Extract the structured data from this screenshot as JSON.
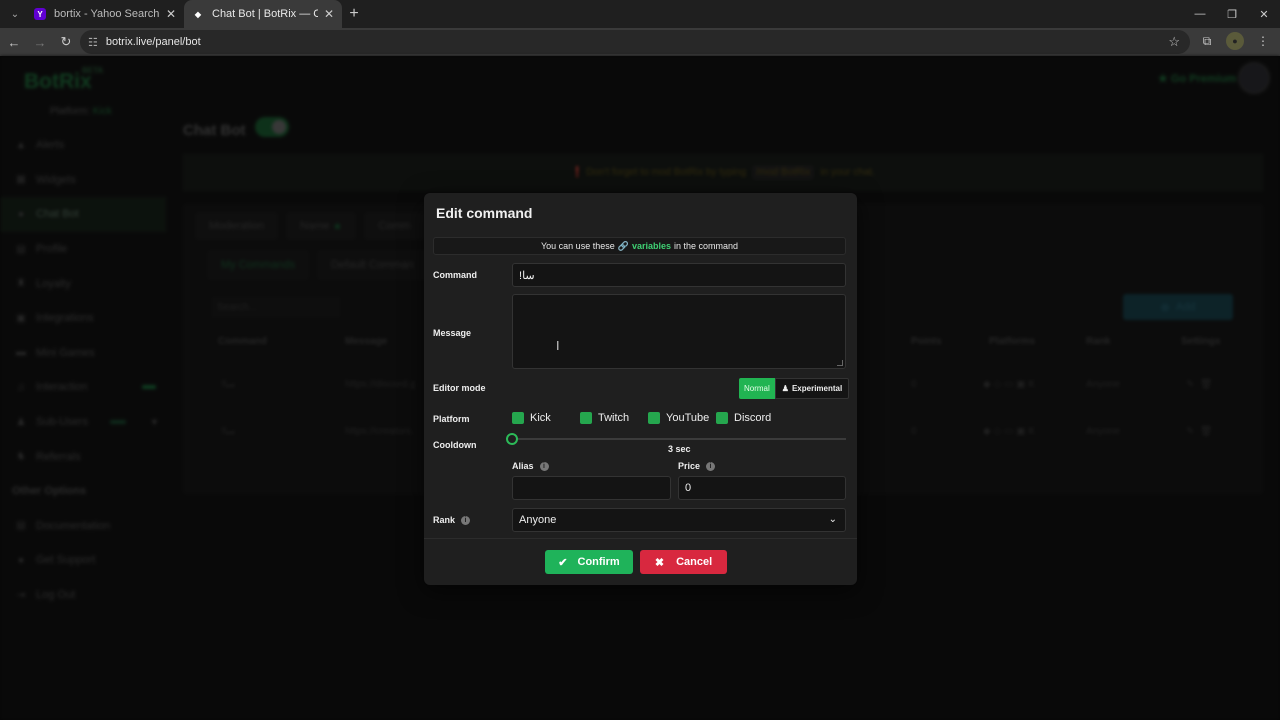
{
  "browser": {
    "tabs": [
      {
        "title": "bortix - Yahoo Search Results",
        "favicon": "Y",
        "favicon_color": "#6001d2"
      },
      {
        "title": "Chat Bot | BotRix — Cloud Strea",
        "favicon": "◆",
        "favicon_color": "#ffffff"
      }
    ],
    "url": "botrix.live/panel/bot"
  },
  "app": {
    "brand": "BotRix",
    "beta": "BETA",
    "platform_label": "Platform:",
    "platform_value": "Kick",
    "premium": "Go Premium",
    "page_title": "Chat Bot",
    "notice": {
      "pre": "Don't forget to mod BotRix by typing",
      "code": "/mod BotRix",
      "post": "in your chat."
    },
    "sidebar": {
      "items": [
        {
          "label": "Alerts",
          "icon": "warning-icon"
        },
        {
          "label": "Widgets",
          "icon": "widgets-icon"
        },
        {
          "label": "Chat Bot",
          "icon": "chat-icon"
        },
        {
          "label": "Profile",
          "icon": "profile-icon"
        },
        {
          "label": "Loyalty",
          "icon": "trophy-icon"
        },
        {
          "label": "Integrations",
          "icon": "integrations-icon"
        },
        {
          "label": "Mini Games",
          "icon": "gamepad-icon"
        },
        {
          "label": "Interaction",
          "icon": "music-icon"
        },
        {
          "label": "Sub-Users",
          "icon": "users-icon"
        },
        {
          "label": "Referrals",
          "icon": "referrals-icon"
        }
      ],
      "section": "Other Options",
      "other": [
        {
          "label": "Documentation",
          "icon": "doc-icon"
        },
        {
          "label": "Get Support",
          "icon": "support-icon"
        },
        {
          "label": "Log Out",
          "icon": "logout-icon"
        }
      ]
    },
    "tabs": [
      "Moderation",
      "Name",
      "Comm"
    ],
    "subtabs": [
      "My Commands",
      "Default Comman"
    ],
    "search_placeholder": "Search...",
    "add_label": "Add",
    "table": {
      "headers": [
        "Command",
        "Message",
        "Points",
        "Platforms",
        "Rank",
        "Settings"
      ],
      "rows": [
        {
          "command": "!سا",
          "message": "https://discord.g",
          "points": "0",
          "rank": "Anyone"
        },
        {
          "command": "!سا",
          "message": "https://creators.",
          "points": "0",
          "rank": "Anyone"
        }
      ]
    }
  },
  "modal": {
    "title": "Edit command",
    "info_pre": "You can use these",
    "info_link": "variables",
    "info_post": "in the command",
    "command_label": "Command",
    "command_value": "!سا",
    "message_label": "Message",
    "message_value": "",
    "editor_mode_label": "Editor mode",
    "mode_normal": "Normal",
    "mode_experimental": "Experimental",
    "platform_label": "Platform",
    "platforms": [
      "Kick",
      "Twitch",
      "YouTube",
      "Discord"
    ],
    "cooldown_label": "Cooldown",
    "cooldown_value": "3 sec",
    "alias_label": "Alias",
    "alias_value": "",
    "price_label": "Price",
    "price_value": "0",
    "rank_label": "Rank",
    "rank_value": "Anyone",
    "confirm": "Confirm",
    "cancel": "Cancel",
    "accent": "#21b452",
    "danger": "#d8283f"
  }
}
